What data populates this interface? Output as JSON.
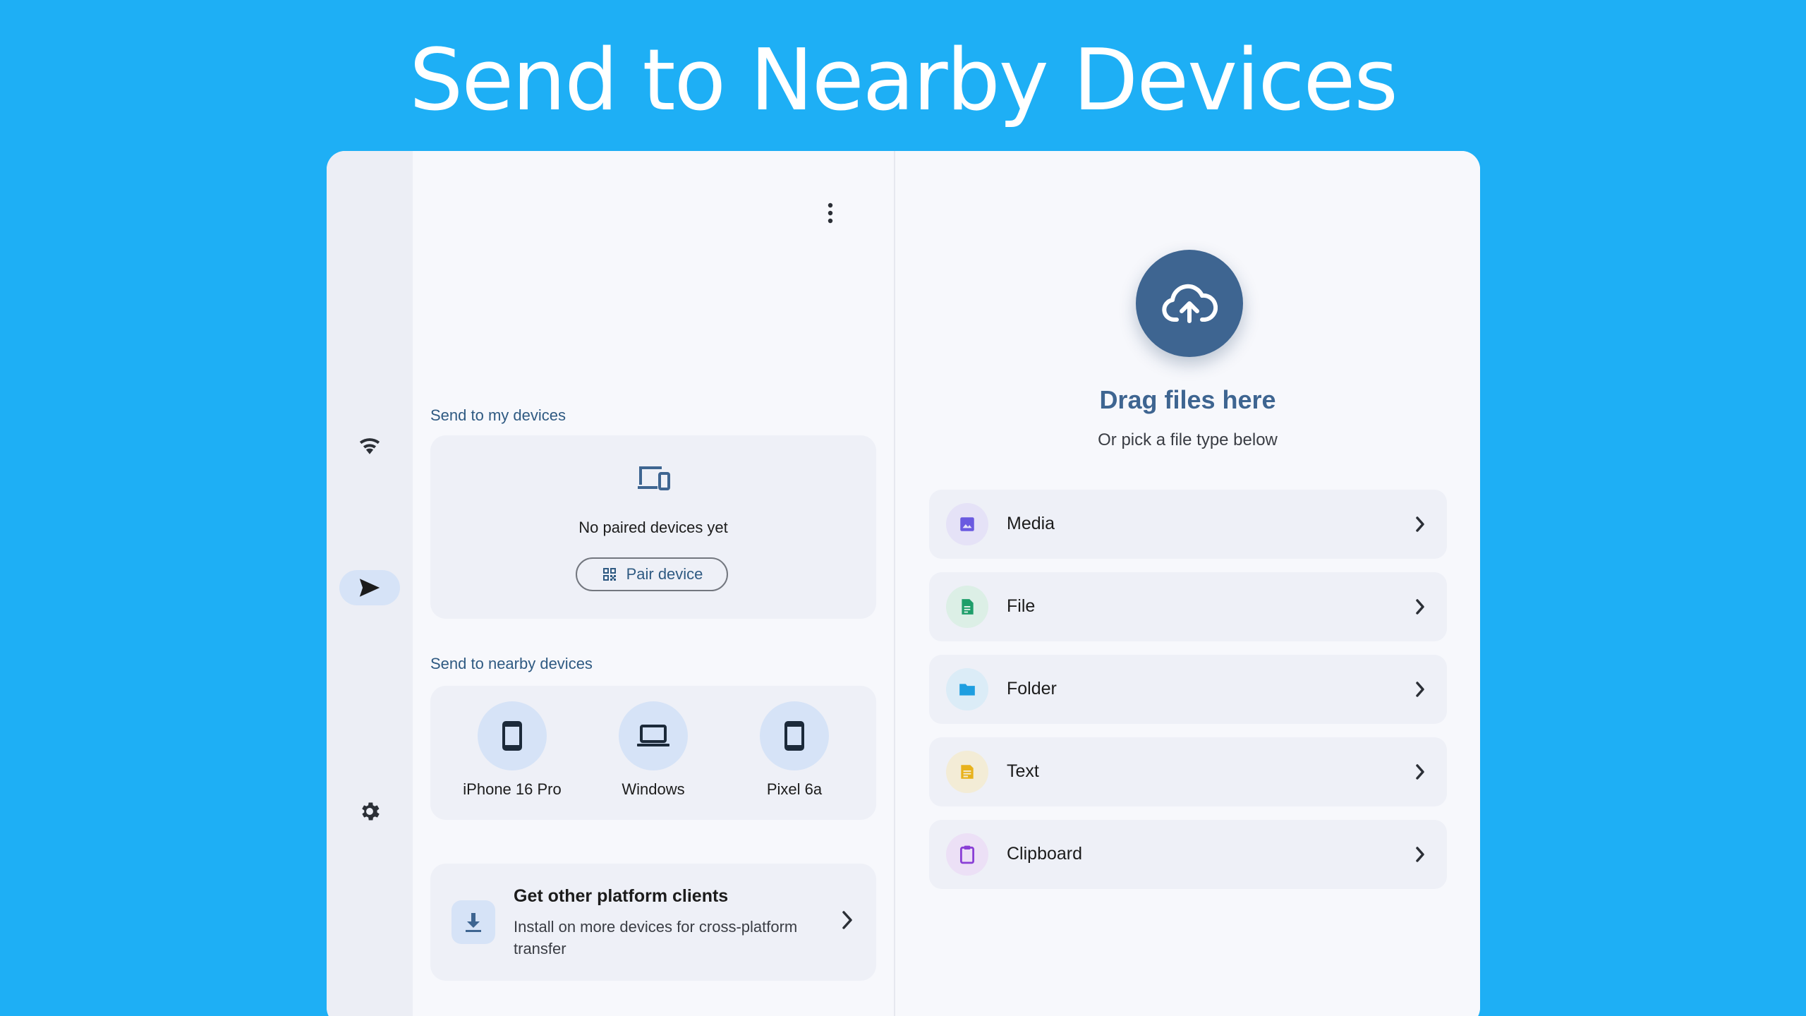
{
  "headline": "Send to Nearby Devices",
  "rail": {
    "items": [
      {
        "name": "wifi",
        "icon": "wifi-icon"
      },
      {
        "name": "send",
        "icon": "send-icon",
        "active": true
      },
      {
        "name": "settings",
        "icon": "gear-icon"
      }
    ]
  },
  "my_devices": {
    "label": "Send to my devices",
    "empty_text": "No paired devices yet",
    "pair_button": "Pair device"
  },
  "nearby": {
    "label": "Send to nearby devices",
    "devices": [
      {
        "name": "iPhone 16 Pro",
        "icon": "phone-icon"
      },
      {
        "name": "Windows",
        "icon": "laptop-icon"
      },
      {
        "name": "Pixel 6a",
        "icon": "phone-icon"
      }
    ]
  },
  "clients": {
    "title": "Get other platform clients",
    "description": "Install on more devices for cross-platform transfer"
  },
  "drop_zone": {
    "title": "Drag files here",
    "subtitle": "Or pick a file type below"
  },
  "file_types": [
    {
      "label": "Media",
      "icon": "image-icon",
      "color": "#6a5ae0",
      "bg": "#e5e2f7"
    },
    {
      "label": "File",
      "icon": "document-icon",
      "color": "#1e9e6a",
      "bg": "#dcefe6"
    },
    {
      "label": "Folder",
      "icon": "folder-icon",
      "color": "#1e9ee0",
      "bg": "#dbecf7"
    },
    {
      "label": "Text",
      "icon": "text-icon",
      "color": "#e8b21c",
      "bg": "#f3ecd6"
    },
    {
      "label": "Clipboard",
      "icon": "clipboard-icon",
      "color": "#8a3fd6",
      "bg": "#ece0f6"
    }
  ],
  "colors": {
    "background": "#1eaff5",
    "accent": "#3e6591",
    "chip": "#d6e3f7"
  }
}
